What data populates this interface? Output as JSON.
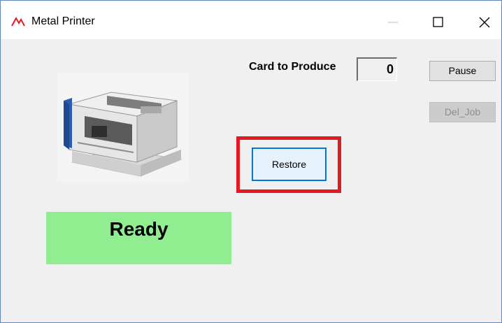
{
  "window": {
    "title": "Metal Printer",
    "app_icon": "metal-printer-logo-icon",
    "controls": {
      "minimize": "minimize-icon",
      "maximize": "maximize-icon",
      "close": "close-icon"
    }
  },
  "card_to_produce": {
    "label": "Card to Produce",
    "value": "0"
  },
  "buttons": {
    "pause": "Pause",
    "del_job": "Del_Job",
    "restore": "Restore"
  },
  "status": {
    "text": "Ready",
    "color": "#90ee90"
  },
  "highlight_color": "#e01b24",
  "image": {
    "subject": "metal card printer machine"
  }
}
